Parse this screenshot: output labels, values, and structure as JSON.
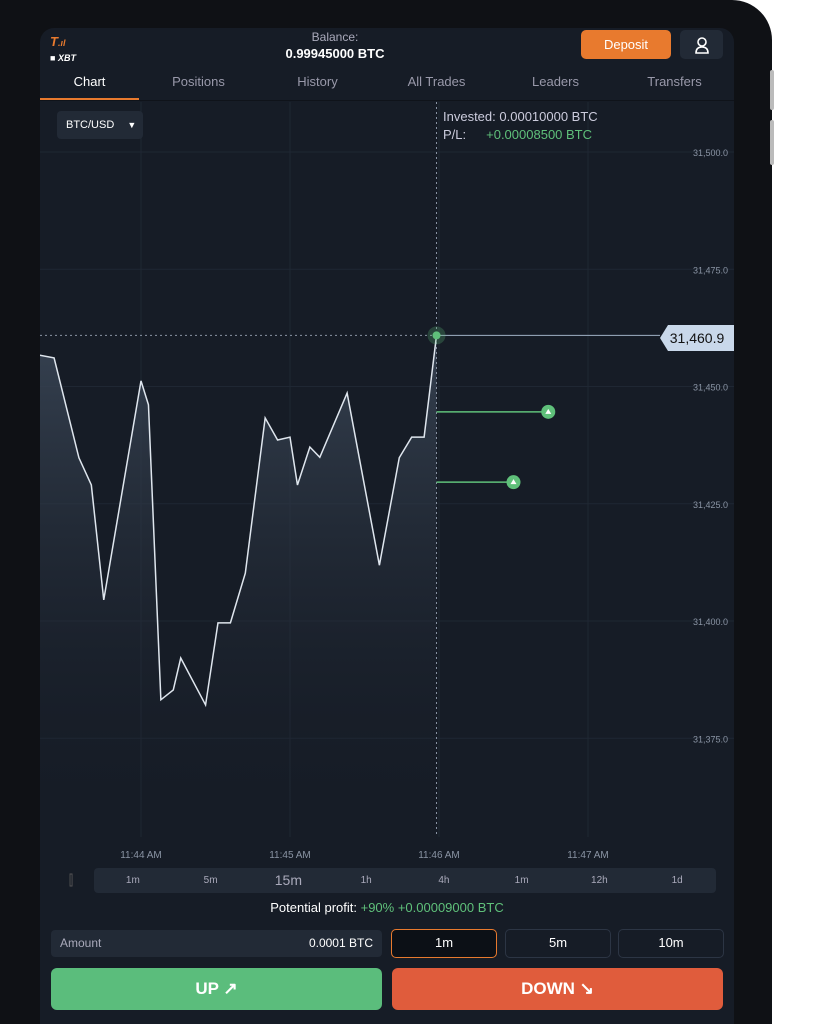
{
  "header": {
    "logo": "XBT",
    "balance_label": "Balance:",
    "balance_value": "0.99945000 BTC",
    "deposit_label": "Deposit",
    "user_icon": "user-icon"
  },
  "tabs": [
    {
      "label": "Chart",
      "active": true
    },
    {
      "label": "Positions"
    },
    {
      "label": "History"
    },
    {
      "label": "All Trades"
    },
    {
      "label": "Leaders"
    },
    {
      "label": "Transfers"
    }
  ],
  "pair": {
    "label": "BTC/USD"
  },
  "position": {
    "invested_label": "Invested:",
    "invested_value": "0.00010000 BTC",
    "pl_label": "P/L:",
    "pl_value": "+0.00008500 BTC"
  },
  "colors": {
    "accent": "#e87a2e",
    "up": "#5bbd7c",
    "down": "#e05c3c",
    "profit": "#5fc07a",
    "line": "#dfe6ee"
  },
  "chart_data": {
    "type": "area",
    "y_ticks": [
      "31,500.0",
      "31,475.0",
      "31,450.0",
      "31,425.0",
      "31,400.0",
      "31,375.0"
    ],
    "y_tick_values": [
      31500,
      31475,
      31450,
      31425,
      31400,
      31375
    ],
    "x_ticks": [
      "11:44 AM",
      "11:45 AM",
      "11:46 AM",
      "11:47 AM"
    ],
    "grid": true,
    "current_price": "31,460.9",
    "current_value": 31460.9,
    "points": [
      [
        "11:43:19",
        31456.7
      ],
      [
        "11:43:25",
        31456.1
      ],
      [
        "11:43:35",
        31434.8
      ],
      [
        "11:43:40",
        31429.0
      ],
      [
        "11:43:45",
        31404.5
      ],
      [
        "11:44:00",
        31451.2
      ],
      [
        "11:44:03",
        31446.1
      ],
      [
        "11:44:08",
        31383.2
      ],
      [
        "11:44:13",
        31385.3
      ],
      [
        "11:44:16",
        31392.1
      ],
      [
        "11:44:26",
        31382.1
      ],
      [
        "11:44:31",
        31399.6
      ],
      [
        "11:44:36",
        31399.6
      ],
      [
        "11:44:42",
        31410.2
      ],
      [
        "11:44:50",
        31443.3
      ],
      [
        "11:44:55",
        31438.6
      ],
      [
        "11:45:00",
        31439.2
      ],
      [
        "11:45:03",
        31429.0
      ],
      [
        "11:45:08",
        31437.1
      ],
      [
        "11:45:12",
        31434.9
      ],
      [
        "11:45:23",
        31448.6
      ],
      [
        "11:45:36",
        31411.9
      ],
      [
        "11:45:44",
        31434.8
      ],
      [
        "11:45:49",
        31439.2
      ],
      [
        "11:45:54",
        31439.2
      ],
      [
        "11:45:59",
        31460.9
      ]
    ],
    "trades": [
      {
        "price": 31444.6,
        "expiry": "11:46:44",
        "direction": "up"
      },
      {
        "price": 31429.6,
        "expiry": "11:46:30",
        "direction": "up"
      }
    ]
  },
  "timeframes": [
    "1m",
    "5m",
    "15m",
    "1h",
    "4h",
    "1m",
    "12h",
    "1d"
  ],
  "profit": {
    "label": "Potential profit:",
    "value": "+90% +0.00009000 BTC"
  },
  "amount": {
    "label": "Amount",
    "value": "0.0001 BTC"
  },
  "durations": [
    {
      "label": "1m",
      "selected": true
    },
    {
      "label": "5m"
    },
    {
      "label": "10m"
    }
  ],
  "actions": {
    "up": "UP ↗",
    "down": "DOWN ↘"
  }
}
